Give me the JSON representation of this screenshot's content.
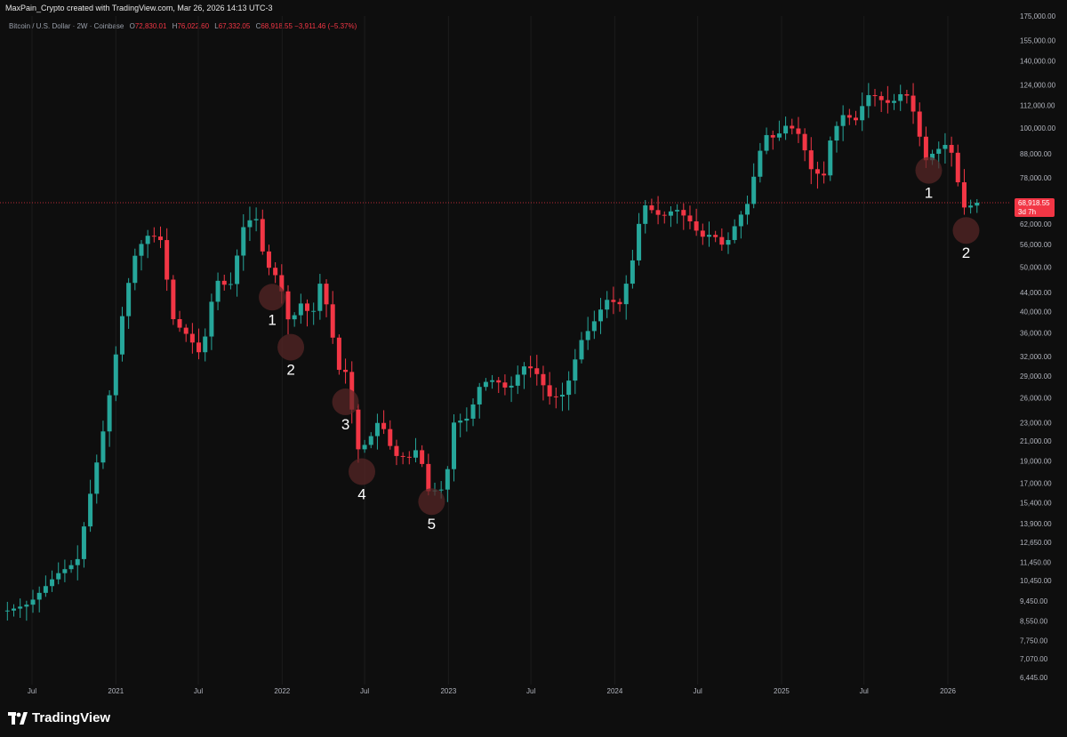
{
  "header": {
    "credit": "MaxPain_Crypto created with TradingView.com, Mar 26, 2026 14:13 UTC-3",
    "symbol": "Bitcoin / U.S. Dollar · 2W · Coinbase",
    "open_label": "O",
    "open_value": "72,830.01",
    "high_label": "H",
    "high_value": "76,022.60",
    "low_label": "L",
    "low_value": "67,332.05",
    "close_label": "C",
    "close_value": "68,918.55 −3,911.46 (−5.37%)"
  },
  "price_tag": {
    "price": "68,918.55",
    "countdown": "3d 7h"
  },
  "brand": {
    "name": "TradingView"
  },
  "colors": {
    "background": "#0e0e0e",
    "up": "#26a69a",
    "down": "#f23645",
    "marker": "#5a2626",
    "axis_text": "#b2b5be"
  },
  "chart_data": {
    "type": "candlestick",
    "title": "",
    "x_axis": {
      "ticks": [
        "Jul",
        "2021",
        "Jul",
        "2022",
        "Jul",
        "2023",
        "Jul",
        "2024",
        "Jul",
        "2025",
        "Jul",
        "2026"
      ],
      "tick_dates": [
        "2020-07-01",
        "2021-01-01",
        "2021-07-01",
        "2022-01-01",
        "2022-07-01",
        "2023-01-01",
        "2023-07-01",
        "2024-01-01",
        "2024-07-01",
        "2025-01-01",
        "2025-07-01",
        "2026-01-01"
      ]
    },
    "y_axis": {
      "scale": "log",
      "ticks": [
        175000,
        155000,
        140000,
        124000,
        112000,
        100000,
        88000,
        78000,
        62000,
        56000,
        50000,
        44000,
        40000,
        36000,
        32000,
        29000,
        26000,
        23000,
        21000,
        19000,
        17000,
        15400,
        13900,
        12650,
        11450,
        10450,
        9450,
        8550,
        7750,
        7070,
        6445
      ],
      "tick_labels": [
        "175,000.00",
        "155,000.00",
        "140,000.00",
        "124,000.00",
        "112,000.00",
        "100,000.00",
        "88,000.00",
        "78,000.00",
        "62,000.00",
        "56,000.00",
        "50,000.00",
        "44,000.00",
        "40,000.00",
        "36,000.00",
        "32,000.00",
        "29,000.00",
        "26,000.00",
        "23,000.00",
        "21,000.00",
        "19,000.00",
        "17,000.00",
        "15,400.00",
        "13,900.00",
        "12,650.00",
        "11,450.00",
        "10,450.00",
        "9,450.00",
        "8,550.00",
        "7,750.00",
        "7,070.00",
        "6,445.00"
      ]
    },
    "last_price": 68918.55,
    "anchors": [
      [
        "2020-05-15",
        9000
      ],
      [
        "2020-07-01",
        9300
      ],
      [
        "2020-09-01",
        10800
      ],
      [
        "2020-10-15",
        11500
      ],
      [
        "2020-11-15",
        16500
      ],
      [
        "2020-12-15",
        23000
      ],
      [
        "2021-01-01",
        29000
      ],
      [
        "2021-01-15",
        36000
      ],
      [
        "2021-02-15",
        52000
      ],
      [
        "2021-03-15",
        58500
      ],
      [
        "2021-04-15",
        58000
      ],
      [
        "2021-05-15",
        38000
      ],
      [
        "2021-06-15",
        35500
      ],
      [
        "2021-07-15",
        32000
      ],
      [
        "2021-08-15",
        47000
      ],
      [
        "2021-09-15",
        45000
      ],
      [
        "2021-10-15",
        61000
      ],
      [
        "2021-11-10",
        65000
      ],
      [
        "2021-12-01",
        51000
      ],
      [
        "2022-01-01",
        47000
      ],
      [
        "2022-01-25",
        37000
      ],
      [
        "2022-02-15",
        42000
      ],
      [
        "2022-03-15",
        39000
      ],
      [
        "2022-04-01",
        46000
      ],
      [
        "2022-04-20",
        40000
      ],
      [
        "2022-05-10",
        30000
      ],
      [
        "2022-06-01",
        29500
      ],
      [
        "2022-06-20",
        20000
      ],
      [
        "2022-07-15",
        20800
      ],
      [
        "2022-08-10",
        23500
      ],
      [
        "2022-09-10",
        19500
      ],
      [
        "2022-10-15",
        19300
      ],
      [
        "2022-11-05",
        20500
      ],
      [
        "2022-11-20",
        16300
      ],
      [
        "2022-12-31",
        16500
      ],
      [
        "2023-01-20",
        23000
      ],
      [
        "2023-02-20",
        23500
      ],
      [
        "2023-03-20",
        28000
      ],
      [
        "2023-04-20",
        28500
      ],
      [
        "2023-05-20",
        27000
      ],
      [
        "2023-06-20",
        30500
      ],
      [
        "2023-07-15",
        30000
      ],
      [
        "2023-08-20",
        26000
      ],
      [
        "2023-09-20",
        26500
      ],
      [
        "2023-10-25",
        34500
      ],
      [
        "2023-11-20",
        37500
      ],
      [
        "2023-12-20",
        42500
      ],
      [
        "2024-01-20",
        41500
      ],
      [
        "2024-02-15",
        51000
      ],
      [
        "2024-03-01",
        62000
      ],
      [
        "2024-03-15",
        68000
      ],
      [
        "2024-04-20",
        64000
      ],
      [
        "2024-05-20",
        67000
      ],
      [
        "2024-06-20",
        63000
      ],
      [
        "2024-07-15",
        58000
      ],
      [
        "2024-08-10",
        59000
      ],
      [
        "2024-09-05",
        55000
      ],
      [
        "2024-10-01",
        62500
      ],
      [
        "2024-10-25",
        68500
      ],
      [
        "2024-11-10",
        80000
      ],
      [
        "2024-12-01",
        97000
      ],
      [
        "2024-12-25",
        95000
      ],
      [
        "2025-01-20",
        102000
      ],
      [
        "2025-02-20",
        96000
      ],
      [
        "2025-03-10",
        82000
      ],
      [
        "2025-04-10",
        78000
      ],
      [
        "2025-04-25",
        94000
      ],
      [
        "2025-05-20",
        107000
      ],
      [
        "2025-06-20",
        104000
      ],
      [
        "2025-07-15",
        118000
      ],
      [
        "2025-08-10",
        117000
      ],
      [
        "2025-08-20",
        113000
      ],
      [
        "2025-09-10",
        114000
      ],
      [
        "2025-10-05",
        121000
      ],
      [
        "2025-10-25",
        108000
      ],
      [
        "2025-11-20",
        85000
      ],
      [
        "2025-12-10",
        89000
      ],
      [
        "2026-01-10",
        93000
      ],
      [
        "2026-01-25",
        82000
      ],
      [
        "2026-02-05",
        70000
      ],
      [
        "2026-02-20",
        65000
      ],
      [
        "2026-03-10",
        72830
      ],
      [
        "2026-03-26",
        68918.55
      ]
    ],
    "annotations": [
      {
        "label": "1",
        "date": "2021-12-10",
        "price": 43000
      },
      {
        "label": "2",
        "date": "2022-01-20",
        "price": 33500
      },
      {
        "label": "3",
        "date": "2022-05-20",
        "price": 25500
      },
      {
        "label": "4",
        "date": "2022-06-25",
        "price": 18000
      },
      {
        "label": "5",
        "date": "2022-11-25",
        "price": 15500
      },
      {
        "label": "1",
        "date": "2025-11-20",
        "price": 81000
      },
      {
        "label": "2",
        "date": "2026-02-10",
        "price": 60000
      }
    ]
  }
}
